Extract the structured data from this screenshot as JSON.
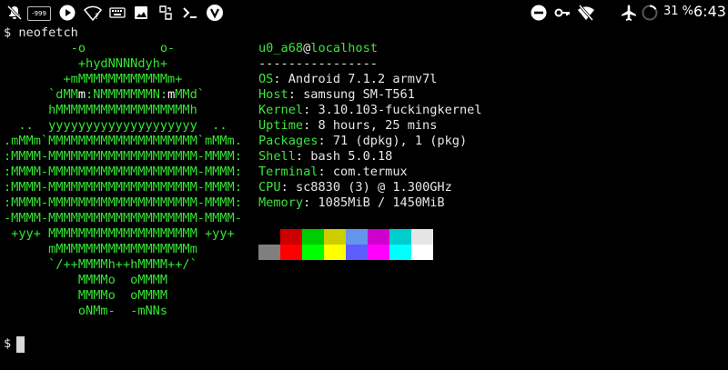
{
  "status_bar": {
    "left_icons": [
      "silent-mode-icon",
      "number-badge-icon",
      "play-icon",
      "nfc-icon",
      "wifi-question-icon",
      "keyboard-icon",
      "image-icon",
      "transfer-icon",
      "terminal-icon",
      "vivaldi-icon"
    ],
    "badge_text": "-999",
    "right_icons": [
      "do-not-disturb-icon",
      "key-icon",
      "wifi-off-icon",
      "airplane-icon",
      "battery-charging-icon"
    ],
    "battery": "31 %",
    "time": "6:43"
  },
  "terminal": {
    "command_prompt": "$ neofetch",
    "ascii_art": [
      "         -o          o-",
      "          +hydNNNNdyh+",
      "        +mMMMMMMMMMMMMm+",
      "      `dMM[m]:NMMMMMMMN:[m]MMd`",
      "      hMMMMMMMMMMMMMMMMMMh",
      "  ..  yyyyyyyyyyyyyyyyyyyy  ..",
      ".mMMm`MMMMMMMMMMMMMMMMMMMM`mMMm.",
      ":MMMM-MMMMMMMMMMMMMMMMMMMM-MMMM:",
      ":MMMM-MMMMMMMMMMMMMMMMMMMM-MMMM:",
      ":MMMM-MMMMMMMMMMMMMMMMMMMM-MMMM:",
      ":MMMM-MMMMMMMMMMMMMMMMMMMM-MMMM:",
      "-MMMM-MMMMMMMMMMMMMMMMMMMM-MMMM-",
      " +yy+ MMMMMMMMMMMMMMMMMMMM +yy+",
      "      mMMMMMMMMMMMMMMMMMMm",
      "      `/++MMMMh++hMMMM++/`",
      "          MMMMo  oMMMM",
      "          MMMMo  oMMMM",
      "          oNMm-  -mNNs"
    ],
    "info": {
      "user": "u0_a68",
      "at": "@",
      "host": "localhost",
      "separator": "----------------",
      "fields": [
        {
          "key": "OS",
          "value": "Android 7.1.2 armv7l"
        },
        {
          "key": "Host",
          "value": "samsung SM-T561"
        },
        {
          "key": "Kernel",
          "value": "3.10.103-fuckingkernel"
        },
        {
          "key": "Uptime",
          "value": "8 hours, 25 mins"
        },
        {
          "key": "Packages",
          "value": "71 (dpkg), 1 (pkg)"
        },
        {
          "key": "Shell",
          "value": "bash 5.0.18"
        },
        {
          "key": "Terminal",
          "value": "com.termux"
        },
        {
          "key": "CPU",
          "value": "sc8830 (3) @ 1.300GHz"
        },
        {
          "key": "Memory",
          "value": "1085MiB / 1450MiB"
        }
      ],
      "separator_colon": ": "
    },
    "palette": {
      "normal": [
        "#000000",
        "#cd0000",
        "#00cd00",
        "#cdcd00",
        "#6495ed",
        "#cd00cd",
        "#00cdcd",
        "#e5e5e5"
      ],
      "bright": [
        "#7f7f7f",
        "#ff0000",
        "#00ff00",
        "#ffff00",
        "#5c5cff",
        "#ff00ff",
        "#00ffff",
        "#ffffff"
      ]
    },
    "next_prompt": "$ "
  }
}
